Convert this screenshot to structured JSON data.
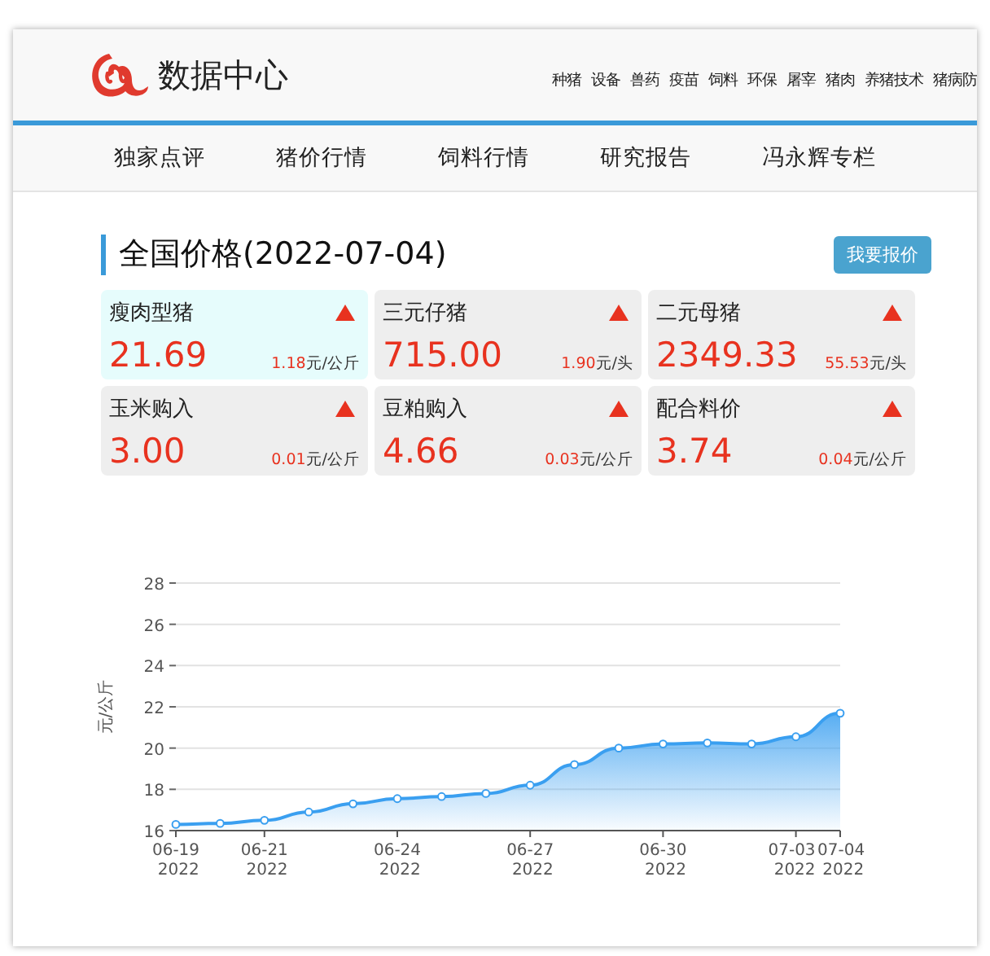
{
  "header": {
    "site_title": "数据中心",
    "top_links": [
      "种猪",
      "设备",
      "兽药",
      "疫苗",
      "饲料",
      "环保",
      "屠宰",
      "猪肉",
      "养猪技术",
      "猪病防"
    ]
  },
  "nav": [
    "独家点评",
    "猪价行情",
    "饲料行情",
    "研究报告",
    "冯永辉专栏"
  ],
  "section": {
    "title": "全国价格(2022-07-04)",
    "quote_button": "我要报价"
  },
  "prices": [
    {
      "name": "瘦肉型猪",
      "value": "21.69",
      "change": "1.18",
      "unit": "元/公斤",
      "rising": true,
      "selected": true
    },
    {
      "name": "三元仔猪",
      "value": "715.00",
      "change": "1.90",
      "unit": "元/头",
      "rising": true,
      "selected": false
    },
    {
      "name": "二元母猪",
      "value": "2349.33",
      "change": "55.53",
      "unit": "元/头",
      "rising": true,
      "selected": false
    },
    {
      "name": "玉米购入",
      "value": "3.00",
      "change": "0.01",
      "unit": "元/公斤",
      "rising": true,
      "selected": false
    },
    {
      "name": "豆粕购入",
      "value": "4.66",
      "change": "0.03",
      "unit": "元/公斤",
      "rising": true,
      "selected": false
    },
    {
      "name": "配合料价",
      "value": "3.74",
      "change": "0.04",
      "unit": "元/公斤",
      "rising": true,
      "selected": false
    }
  ],
  "chart": {
    "chart_data": {
      "type": "area",
      "ylabel": "元/公斤",
      "categories": [
        "06-19 2022",
        null,
        "06-21 2022",
        null,
        null,
        "06-24 2022",
        null,
        null,
        "06-27 2022",
        null,
        null,
        "06-30 2022",
        null,
        null,
        "07-03 2022",
        "07-04 2022"
      ],
      "grid": true,
      "series": [
        {
          "color": "#3a9ff0",
          "values": [
            16.3,
            16.35,
            16.5,
            16.9,
            17.3,
            17.55,
            17.65,
            17.8,
            18.2,
            19.2,
            20.0,
            20.2,
            20.25,
            20.2,
            20.55,
            21.69
          ]
        }
      ],
      "ylim": [
        16,
        28
      ],
      "yticks": [
        16,
        18,
        20,
        22,
        24,
        26,
        28
      ]
    }
  }
}
